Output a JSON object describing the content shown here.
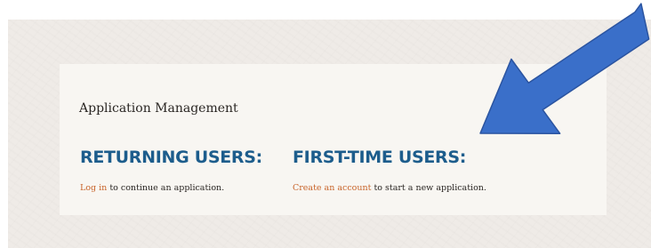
{
  "heading": "Application Management",
  "returning": {
    "title": "RETURNING USERS:",
    "link": "Log in",
    "text": "to continue an application."
  },
  "first_time": {
    "title": "FIRST-TIME USERS:",
    "link": "Create an account",
    "text": "to start a new application."
  },
  "colors": {
    "title_blue": "#1d5d8c",
    "link_orange": "#c8642a",
    "arrow_blue": "#3a6fc9",
    "card": "#f8f6f2",
    "backdrop": "#efebe7"
  },
  "icons": [
    "arrow-pointer-icon"
  ]
}
